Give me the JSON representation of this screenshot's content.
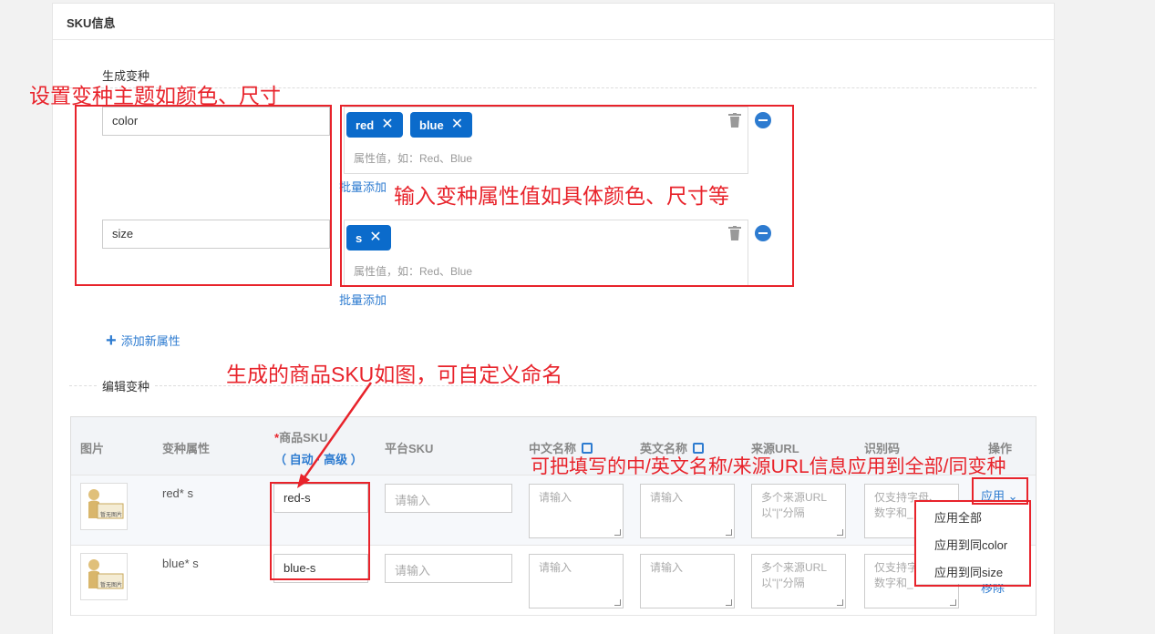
{
  "panel": {
    "title": "SKU信息"
  },
  "generate": {
    "title": "生成变种",
    "attributes": [
      {
        "name": "color",
        "tags": [
          "red",
          "blue"
        ],
        "placeholder": "属性值，如：Red、Blue",
        "bulk_add": "批量添加"
      },
      {
        "name": "size",
        "tags": [
          "s"
        ],
        "placeholder": "属性值，如：Red、Blue",
        "bulk_add": "批量添加"
      }
    ],
    "add_attribute": "添加新属性"
  },
  "edit": {
    "title": "编辑变种",
    "headers": {
      "image": "图片",
      "variant_attr": "变种属性",
      "sku_required_mark": "*",
      "sku": "商品SKU",
      "sku_modes": "（ 自动 · 高级 ）",
      "platform_sku": "平台SKU",
      "cn_name": "中文名称",
      "en_name": "英文名称",
      "source_url": "来源URL",
      "code": "识别码",
      "action": "操作"
    },
    "rows": [
      {
        "thumb_text": "暂无图片",
        "variant": "red* s",
        "sku": "red-s",
        "platform_sku_ph": "请输入",
        "cn_ph": "请输入",
        "en_ph": "请输入",
        "url_ph": "多个来源URL以\"|\"分隔",
        "code_ph": "仅支持字母、数字和_"
      },
      {
        "thumb_text": "暂无图片",
        "variant": "blue* s",
        "sku": "blue-s",
        "platform_sku_ph": "请输入",
        "cn_ph": "请输入",
        "en_ph": "请输入",
        "url_ph": "多个来源URL以\"|\"分隔",
        "code_ph": "仅支持字母、数字和_"
      }
    ],
    "apply_button": "应用",
    "apply_menu": [
      "应用全部",
      "应用到同color",
      "应用到同size"
    ],
    "delete_text": "移除"
  },
  "annotations": {
    "theme": "设置变种主题如颜色、尺寸",
    "values": "输入变种属性值如具体颜色、尺寸等",
    "sku": "生成的商品SKU如图，可自定义命名",
    "apply": "可把填写的中/英文名称/来源URL信息应用到全部/同变种"
  },
  "colors": {
    "accent": "#0b6bcb",
    "link": "#2d7bd0",
    "annotation": "#e8232b"
  }
}
